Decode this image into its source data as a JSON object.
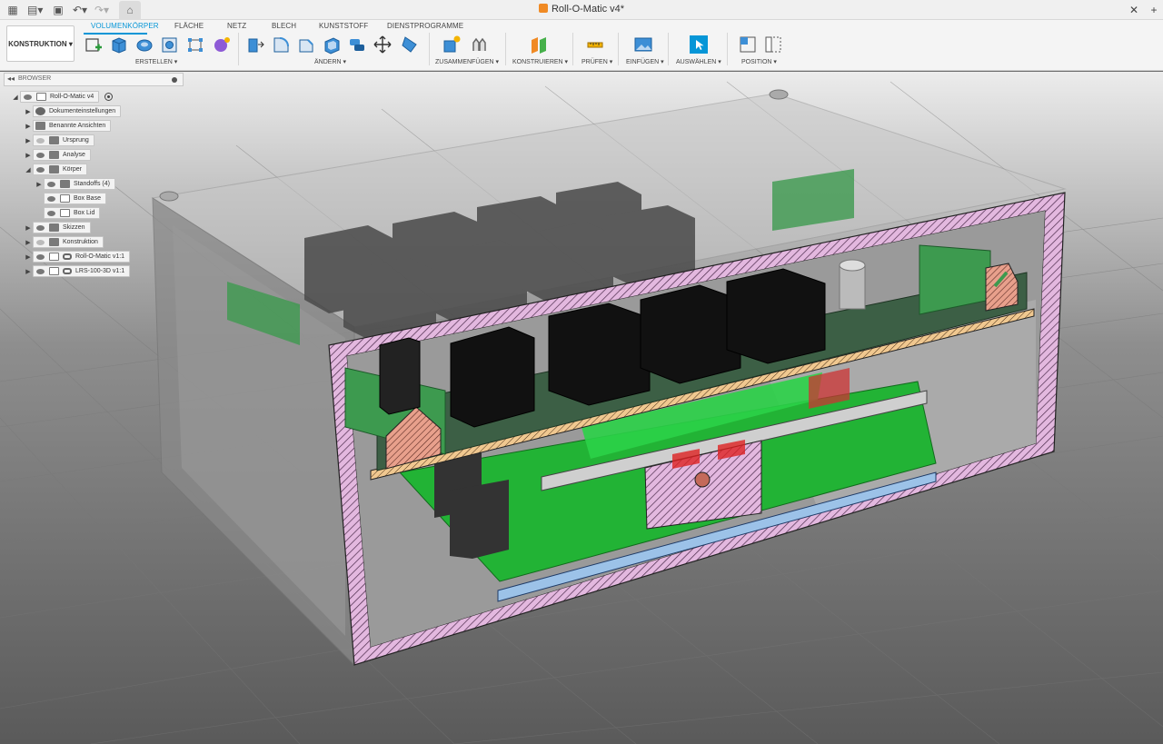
{
  "titlebar": {
    "doc_title": "Roll-O-Matic v4*"
  },
  "workspace": {
    "label": "KONSTRUKTION ▾"
  },
  "ribbon": {
    "tabs": [
      {
        "label": "VOLUMENKÖRPER",
        "active": true
      },
      {
        "label": "FLÄCHE"
      },
      {
        "label": "NETZ"
      },
      {
        "label": "BLECH"
      },
      {
        "label": "KUNSTSTOFF"
      },
      {
        "label": "DIENSTPROGRAMME"
      }
    ],
    "groups": [
      {
        "label": "ERSTELLEN ▾"
      },
      {
        "label": "ÄNDERN ▾"
      },
      {
        "label": "ZUSAMMENFÜGEN ▾"
      },
      {
        "label": "KONSTRUIEREN ▾"
      },
      {
        "label": "PRÜFEN ▾"
      },
      {
        "label": "EINFÜGEN ▾"
      },
      {
        "label": "AUSWÄHLEN ▾"
      },
      {
        "label": "POSITION ▾"
      }
    ]
  },
  "browser": {
    "title": "BROWSER",
    "nodes": [
      {
        "label": "Roll-O-Matic v4",
        "icon": "component-icon"
      },
      {
        "label": "Dokumenteinstellungen",
        "icon": "gear-icon"
      },
      {
        "label": "Benannte Ansichten",
        "icon": "folder-icon"
      },
      {
        "label": "Ursprung",
        "icon": "folder-icon"
      },
      {
        "label": "Analyse",
        "icon": "folder-icon"
      },
      {
        "label": "Körper",
        "icon": "folder-icon"
      },
      {
        "label": "Standoffs (4)",
        "icon": "folder-icon"
      },
      {
        "label": "Box Base",
        "icon": "body-icon"
      },
      {
        "label": "Box Lid",
        "icon": "body-icon"
      },
      {
        "label": "Skizzen",
        "icon": "folder-icon"
      },
      {
        "label": "Konstruktion",
        "icon": "folder-icon"
      },
      {
        "label": "Roll-O-Matic v1:1",
        "icon": "link-icon"
      },
      {
        "label": "LRS-100-3D v1:1",
        "icon": "link-icon"
      }
    ]
  },
  "colors": {
    "accent": "#0696d7",
    "pcb_green": "#22b335",
    "hatch_pink": "#e0b3dc",
    "terminal_green": "#3d9a4f"
  }
}
